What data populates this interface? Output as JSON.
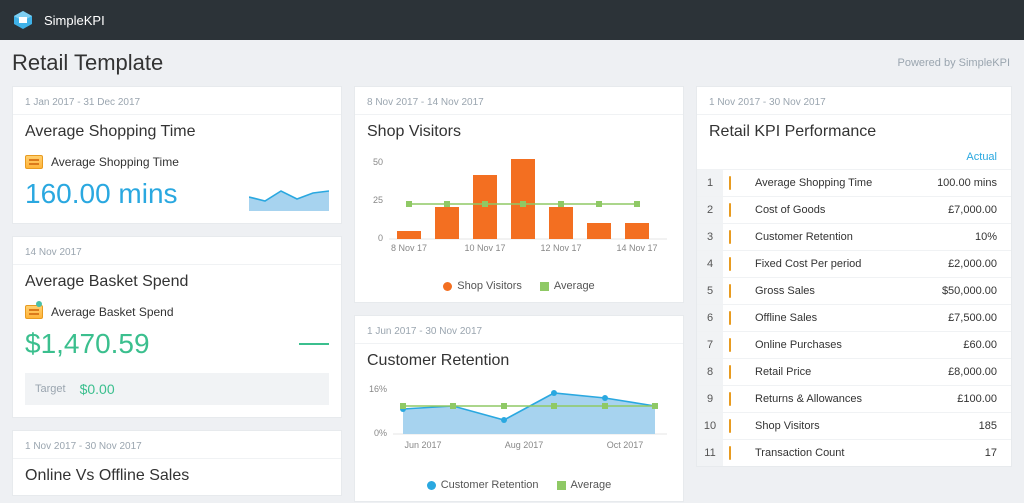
{
  "brand": "SimpleKPI",
  "header": {
    "title": "Retail Template",
    "powered": "Powered by SimpleKPI"
  },
  "card1": {
    "date": "1 Jan 2017 - 31 Dec 2017",
    "title": "Average Shopping Time",
    "metric_label": "Average Shopping Time",
    "value": "160.00 mins"
  },
  "card2": {
    "date": "14 Nov 2017",
    "title": "Average Basket Spend",
    "metric_label": "Average Basket Spend",
    "value": "$1,470.59",
    "target_label": "Target",
    "target_value": "$0.00"
  },
  "card3": {
    "date": "1 Nov 2017 - 30 Nov 2017",
    "title": "Online Vs Offline Sales"
  },
  "card4": {
    "date": "8 Nov 2017 - 14 Nov 2017",
    "title": "Shop Visitors",
    "legend1": "Shop Visitors",
    "legend2": "Average"
  },
  "card5": {
    "date": "1 Jun 2017 - 30 Nov 2017",
    "title": "Customer Retention",
    "legend1": "Customer Retention",
    "legend2": "Average"
  },
  "card6": {
    "date": "1 Nov 2017 - 30 Nov 2017",
    "title": "Retail KPI Performance",
    "col_actual": "Actual",
    "rows": [
      {
        "idx": "1",
        "name": "Average Shopping Time",
        "value": "100.00 mins"
      },
      {
        "idx": "2",
        "name": "Cost of Goods",
        "value": "£7,000.00"
      },
      {
        "idx": "3",
        "name": "Customer Retention",
        "value": "10%"
      },
      {
        "idx": "4",
        "name": "Fixed Cost Per period",
        "value": "£2,000.00"
      },
      {
        "idx": "5",
        "name": "Gross Sales",
        "value": "$50,000.00"
      },
      {
        "idx": "6",
        "name": "Offline Sales",
        "value": "£7,500.00"
      },
      {
        "idx": "7",
        "name": "Online Purchases",
        "value": "£60.00"
      },
      {
        "idx": "8",
        "name": "Retail Price",
        "value": "£8,000.00"
      },
      {
        "idx": "9",
        "name": "Returns & Allowances",
        "value": "£100.00"
      },
      {
        "idx": "10",
        "name": "Shop Visitors",
        "value": "185"
      },
      {
        "idx": "11",
        "name": "Transaction Count",
        "value": "17"
      }
    ]
  },
  "chart_data": [
    {
      "type": "bar",
      "title": "Shop Visitors",
      "categories": [
        "8 Nov 17",
        "9 Nov 17",
        "10 Nov 17",
        "11 Nov 17",
        "12 Nov 17",
        "13 Nov 17",
        "14 Nov 17"
      ],
      "visible_ticks": [
        "8 Nov 17",
        "10 Nov 17",
        "12 Nov 17",
        "14 Nov 17"
      ],
      "series": [
        {
          "name": "Shop Visitors",
          "values": [
            5,
            20,
            40,
            50,
            20,
            10,
            10
          ]
        },
        {
          "name": "Average",
          "values": [
            22,
            22,
            22,
            22,
            22,
            22,
            22
          ]
        }
      ],
      "ylim": [
        0,
        50
      ],
      "yticks": [
        0,
        25,
        50
      ]
    },
    {
      "type": "area",
      "title": "Customer Retention",
      "categories": [
        "Jun 2017",
        "Jul 2017",
        "Aug 2017",
        "Sep 2017",
        "Oct 2017",
        "Nov 2017"
      ],
      "visible_ticks": [
        "Jun 2017",
        "Aug 2017",
        "Oct 2017"
      ],
      "series": [
        {
          "name": "Customer Retention",
          "values": [
            9,
            10,
            5,
            15,
            13,
            10
          ]
        },
        {
          "name": "Average",
          "values": [
            10,
            10,
            10,
            10,
            10,
            10
          ]
        }
      ],
      "ylim": [
        0,
        16
      ],
      "yticks": [
        0,
        16
      ],
      "ylabel_suffix": "%"
    }
  ]
}
